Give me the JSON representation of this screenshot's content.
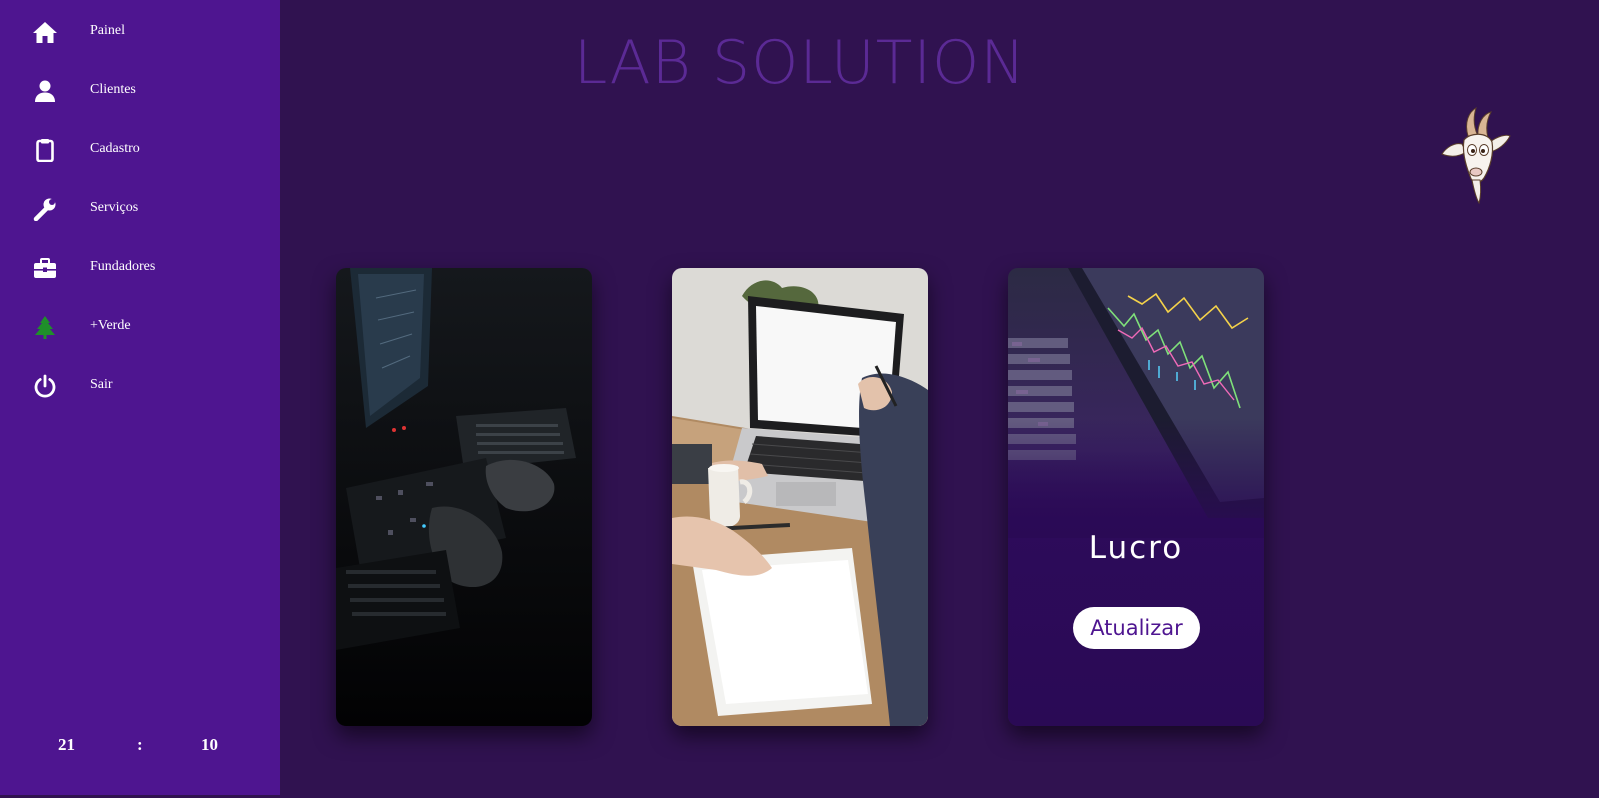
{
  "sidebar": {
    "items": [
      {
        "label": "Painel",
        "icon": "home-icon"
      },
      {
        "label": "Clientes",
        "icon": "user-icon"
      },
      {
        "label": "Cadastro",
        "icon": "clipboard-icon"
      },
      {
        "label": "Serviços",
        "icon": "wrench-icon"
      },
      {
        "label": "Fundadores",
        "icon": "briefcase-icon"
      },
      {
        "label": "+Verde",
        "icon": "tree-icon"
      },
      {
        "label": "Sair",
        "icon": "power-icon"
      }
    ],
    "clock": {
      "hours": "21",
      "separator": ":",
      "minutes": "10"
    }
  },
  "header": {
    "title": "LAB SOLUTION"
  },
  "cards": [
    {
      "image": "hardware-workbench-photo"
    },
    {
      "image": "laptop-desk-photo"
    },
    {
      "image": "stock-chart-photo",
      "title": "Lucro",
      "button_label": "Atualizar"
    }
  ],
  "colors": {
    "sidebar_bg": "#4e1590",
    "page_bg": "#301250",
    "title_color": "#5b2a95",
    "tree_icon": "#1f8f2a"
  }
}
